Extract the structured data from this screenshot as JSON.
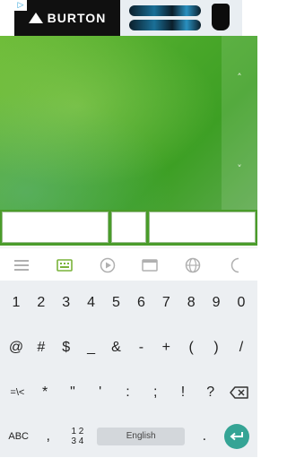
{
  "ad": {
    "brand": "BURTON",
    "choices_icon": "ad-choices-icon"
  },
  "content": {
    "scroll_up": "˄",
    "scroll_down": "˅"
  },
  "inputs": {
    "field1": "",
    "field2": "",
    "field3": ""
  },
  "keyboard_toolbar": {
    "icons": [
      "menu-icon",
      "keyboard-icon",
      "play-icon",
      "clipboard-icon",
      "globe-icon",
      "more-icon"
    ]
  },
  "keyboard": {
    "row1": [
      "1",
      "2",
      "3",
      "4",
      "5",
      "6",
      "7",
      "8",
      "9",
      "0"
    ],
    "row2": [
      "@",
      "#",
      "$",
      "_",
      "&",
      "-",
      "+",
      "(",
      ")",
      "/"
    ],
    "row3": [
      "=\\<",
      "*",
      "\"",
      "'",
      ":",
      ";",
      "!",
      "?"
    ],
    "row4_abc": "ABC",
    "row4_comma": ",",
    "row4_num_top": "1 2",
    "row4_num_bottom": "3 4",
    "space_label": "English",
    "row4_period": "."
  },
  "colors": {
    "accent_green": "#7ab33a",
    "enter_teal": "#35a495",
    "content_green": "#4aa82a"
  }
}
